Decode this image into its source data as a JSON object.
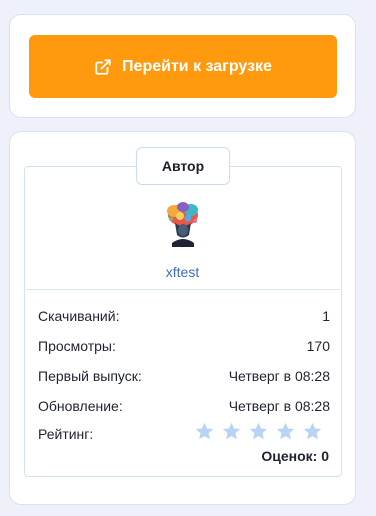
{
  "download": {
    "label": "Перейти к загрузке",
    "icon": "external-link-icon",
    "color": "#ff9a0f"
  },
  "author_section": {
    "title": "Автор",
    "author_name": "xftest",
    "avatar_icon": "avatar-image"
  },
  "stats": {
    "downloads_label": "Скачиваний:",
    "downloads_value": "1",
    "views_label": "Просмотры:",
    "views_value": "170",
    "first_release_label": "Первый выпуск:",
    "first_release_value": "Четверг в 08:28",
    "updated_label": "Обновление:",
    "updated_value": "Четверг в 08:28",
    "rating_label": "Рейтинг:",
    "rating_stars": 0,
    "rating_max": 5,
    "rating_count": "Оценок: 0",
    "star_color": "#b9d4f2"
  }
}
